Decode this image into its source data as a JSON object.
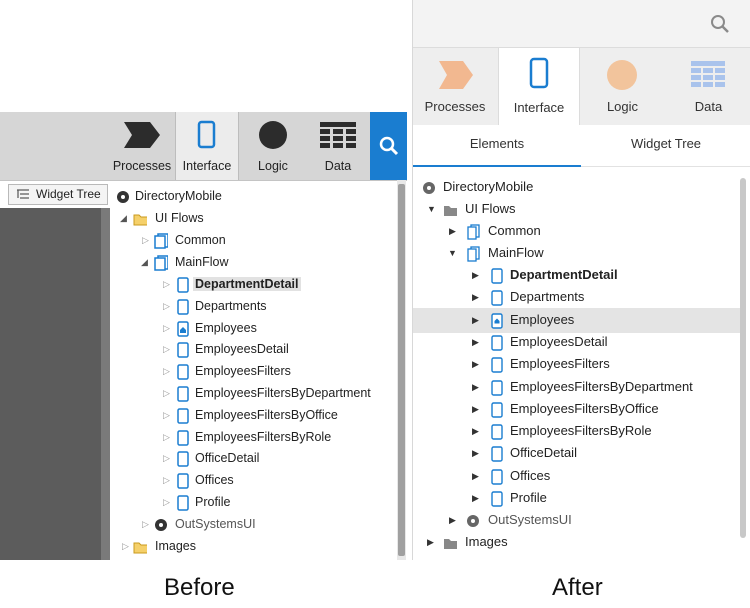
{
  "before": {
    "tabs": [
      {
        "label": "Processes",
        "icon": "processes-icon"
      },
      {
        "label": "Interface",
        "icon": "mobile-device-icon"
      },
      {
        "label": "Logic",
        "icon": "logic-circle-icon"
      },
      {
        "label": "Data",
        "icon": "data-grid-icon"
      }
    ],
    "active_tab": "Interface",
    "search_icon": "search-icon",
    "widget_tree_button": "Widget Tree",
    "tree": {
      "root": "DirectoryMobile",
      "ui_flows": "UI Flows",
      "common": "Common",
      "mainflow": "MainFlow",
      "screens": [
        "DepartmentDetail",
        "Departments",
        "Employees",
        "EmployeesDetail",
        "EmployeesFilters",
        "EmployeesFiltersByDepartment",
        "EmployeesFiltersByOffice",
        "EmployeesFiltersByRole",
        "OfficeDetail",
        "Offices",
        "Profile"
      ],
      "outsystems_ui": "OutSystemsUI",
      "images": "Images"
    },
    "caption": "Before"
  },
  "after": {
    "search_icon": "search-icon",
    "tabs": [
      {
        "label": "Processes",
        "icon": "processes-icon"
      },
      {
        "label": "Interface",
        "icon": "mobile-device-icon"
      },
      {
        "label": "Logic",
        "icon": "logic-circle-icon"
      },
      {
        "label": "Data",
        "icon": "data-grid-icon"
      }
    ],
    "active_tab": "Interface",
    "subtabs": [
      "Elements",
      "Widget Tree"
    ],
    "active_subtab": "Elements",
    "tree": {
      "root": "DirectoryMobile",
      "ui_flows": "UI Flows",
      "common": "Common",
      "mainflow": "MainFlow",
      "screens": [
        "DepartmentDetail",
        "Departments",
        "Employees",
        "EmployeesDetail",
        "EmployeesFilters",
        "EmployeesFiltersByDepartment",
        "EmployeesFiltersByOffice",
        "EmployeesFiltersByRole",
        "OfficeDetail",
        "Offices",
        "Profile"
      ],
      "outsystems_ui": "OutSystemsUI",
      "images": "Images"
    },
    "caption": "After"
  },
  "colors": {
    "accent": "#1a7dd0",
    "folder_before": "#e8b83a",
    "processes_after": "#f2b890",
    "logic_after": "#f2c49c",
    "data_after": "#a9c3ec"
  }
}
